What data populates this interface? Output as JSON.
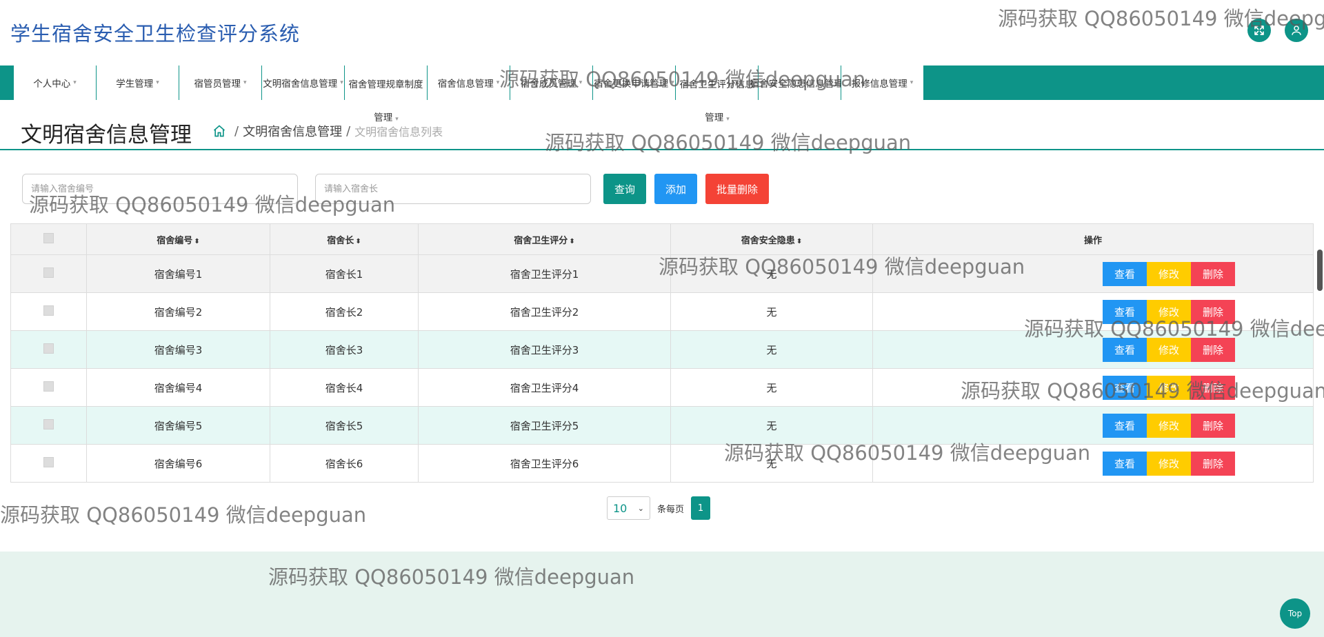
{
  "header": {
    "app_title": "学生宿舍安全卫生检查评分系统"
  },
  "nav": {
    "items": [
      {
        "label": "个人中心",
        "line2": ""
      },
      {
        "label": "学生管理",
        "line2": ""
      },
      {
        "label": "宿管员管理",
        "line2": ""
      },
      {
        "label": "文明宿舍信息管理",
        "line2": ""
      },
      {
        "label": "宿舍管理规章制度",
        "line2": "管理"
      },
      {
        "label": "宿舍信息管理",
        "line2": ""
      },
      {
        "label": "宿舍成员管理",
        "line2": ""
      },
      {
        "label": "宿舍更换申请管理",
        "line2": ""
      },
      {
        "label": "宿舍卫生评分信息",
        "line2": "管理"
      },
      {
        "label": "宿舍安全隐患信息管理",
        "line2": ""
      },
      {
        "label": "报修信息管理",
        "line2": ""
      }
    ]
  },
  "page": {
    "title": "文明宿舍信息管理",
    "breadcrumb_parent": "文明宿舍信息管理",
    "breadcrumb_current": "文明宿舍信息列表"
  },
  "search": {
    "dorm_no_placeholder": "请输入宿舍编号",
    "dorm_leader_placeholder": "请输入宿舍长",
    "query_label": "查询",
    "add_label": "添加",
    "batch_delete_label": "批量删除"
  },
  "table": {
    "headers": [
      "宿舍编号",
      "宿舍长",
      "宿舍卫生评分",
      "宿舍安全隐患",
      "操作"
    ],
    "rows": [
      {
        "dorm_no": "宿舍编号1",
        "leader": "宿舍长1",
        "score": "宿舍卫生评分1",
        "hazard": "无"
      },
      {
        "dorm_no": "宿舍编号2",
        "leader": "宿舍长2",
        "score": "宿舍卫生评分2",
        "hazard": "无"
      },
      {
        "dorm_no": "宿舍编号3",
        "leader": "宿舍长3",
        "score": "宿舍卫生评分3",
        "hazard": "无"
      },
      {
        "dorm_no": "宿舍编号4",
        "leader": "宿舍长4",
        "score": "宿舍卫生评分4",
        "hazard": "无"
      },
      {
        "dorm_no": "宿舍编号5",
        "leader": "宿舍长5",
        "score": "宿舍卫生评分5",
        "hazard": "无"
      },
      {
        "dorm_no": "宿舍编号6",
        "leader": "宿舍长6",
        "score": "宿舍卫生评分6",
        "hazard": "无"
      }
    ],
    "actions": {
      "view": "查看",
      "edit": "修改",
      "delete": "删除"
    }
  },
  "pagination": {
    "page_size": "10",
    "per_page_label": "条每页",
    "current_page": "1"
  },
  "top_label": "Top",
  "watermark": "源码获取 QQ86050149 微信deepguan",
  "colors": {
    "primary": "#0d9488",
    "view": "#2196f3",
    "edit": "#ffcc00",
    "delete": "#f44355"
  }
}
